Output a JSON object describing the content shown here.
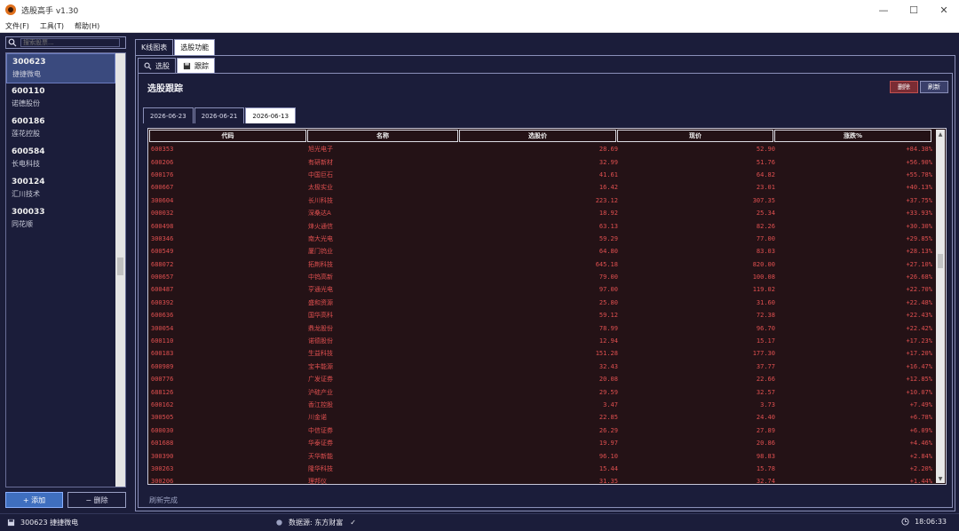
{
  "window": {
    "title": "选股高手 v1.30",
    "ctrl_min": "—",
    "ctrl_max": "☐",
    "ctrl_close": "✕"
  },
  "menu": [
    "文件(F)",
    "工具(T)",
    "帮助(H)"
  ],
  "left": {
    "search_placeholder": "搜索股票...",
    "stocks": [
      {
        "code": "300623",
        "name": "捷捷微电"
      },
      {
        "code": "600110",
        "name": "诺德股份"
      },
      {
        "code": "600186",
        "name": "莲花控股"
      },
      {
        "code": "600584",
        "name": "长电科技"
      },
      {
        "code": "300124",
        "name": "汇川技术"
      },
      {
        "code": "300033",
        "name": "同花顺"
      }
    ],
    "add_label": "+ 添加",
    "delete_label": "− 删除"
  },
  "main": {
    "tabs": [
      "K线图表",
      "选股功能"
    ],
    "sub_tabs": [
      "选股",
      "跟踪"
    ],
    "section_title": "选股跟踪",
    "remove_label": "删除",
    "refresh_label": "刷新",
    "date_tabs": [
      "2026-06-23",
      "2026-06-21",
      "2026-06-13"
    ],
    "columns": [
      "代码",
      "名称",
      "选股价",
      "现价",
      "涨跌%"
    ],
    "rows": [
      [
        "600353",
        "旭光电子",
        "28.69",
        "52.90",
        "+84.38%"
      ],
      [
        "600206",
        "有研新材",
        "32.99",
        "51.76",
        "+56.90%"
      ],
      [
        "600176",
        "中国巨石",
        "41.61",
        "64.82",
        "+55.78%"
      ],
      [
        "600667",
        "太极实业",
        "16.42",
        "23.01",
        "+40.13%"
      ],
      [
        "300604",
        "长川科技",
        "223.12",
        "307.35",
        "+37.75%"
      ],
      [
        "000032",
        "深桑达A",
        "18.92",
        "25.34",
        "+33.93%"
      ],
      [
        "600498",
        "烽火通信",
        "63.13",
        "82.26",
        "+30.30%"
      ],
      [
        "300346",
        "南大光电",
        "59.29",
        "77.00",
        "+29.85%"
      ],
      [
        "600549",
        "厦门钨业",
        "64.80",
        "83.03",
        "+28.13%"
      ],
      [
        "688072",
        "拓荆科技",
        "645.18",
        "820.00",
        "+27.10%"
      ],
      [
        "000657",
        "中钨高新",
        "79.00",
        "100.08",
        "+26.68%"
      ],
      [
        "600487",
        "亨通光电",
        "97.00",
        "119.02",
        "+22.70%"
      ],
      [
        "600392",
        "盛和资源",
        "25.80",
        "31.60",
        "+22.48%"
      ],
      [
        "600636",
        "国华高科",
        "59.12",
        "72.38",
        "+22.43%"
      ],
      [
        "300054",
        "鼎龙股份",
        "78.99",
        "96.70",
        "+22.42%"
      ],
      [
        "600110",
        "诺德股份",
        "12.94",
        "15.17",
        "+17.23%"
      ],
      [
        "600183",
        "生益科技",
        "151.28",
        "177.30",
        "+17.20%"
      ],
      [
        "600989",
        "宝丰能源",
        "32.43",
        "37.77",
        "+16.47%"
      ],
      [
        "000776",
        "广发证券",
        "20.08",
        "22.66",
        "+12.85%"
      ],
      [
        "688126",
        "沪硅产业",
        "29.59",
        "32.57",
        "+10.07%"
      ],
      [
        "600162",
        "香江控股",
        "3.47",
        "3.73",
        "+7.49%"
      ],
      [
        "300505",
        "川金诺",
        "22.85",
        "24.40",
        "+6.78%"
      ],
      [
        "600030",
        "中信证券",
        "26.29",
        "27.89",
        "+6.09%"
      ],
      [
        "601688",
        "华泰证券",
        "19.97",
        "20.86",
        "+4.46%"
      ],
      [
        "300390",
        "天华新能",
        "96.10",
        "98.83",
        "+2.84%"
      ],
      [
        "300263",
        "隆华科技",
        "15.44",
        "15.78",
        "+2.20%"
      ],
      [
        "300206",
        "理邦仪",
        "31.35",
        "32.74",
        "+1.44%"
      ]
    ],
    "status_message": "刷新完成"
  },
  "statusbar": {
    "current_stock": "300623 捷捷微电",
    "data_source": "数据源: 东方财富",
    "check": "✓",
    "time": "18:06:33"
  },
  "colors": {
    "bg": "#1b1d3a",
    "row_text": "#e05050",
    "table_bg": "#241216",
    "accent": "#3f6fbf"
  }
}
